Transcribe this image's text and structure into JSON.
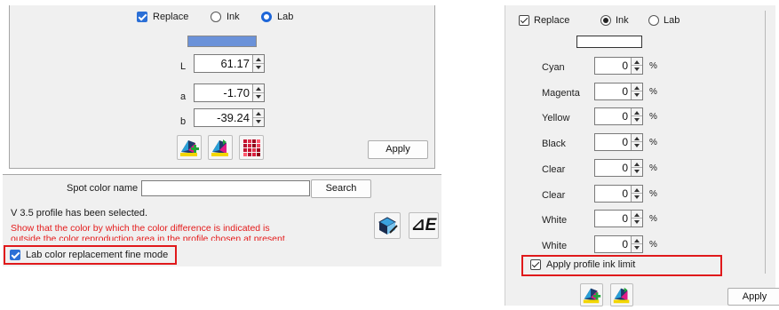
{
  "left": {
    "replace_label": "Replace",
    "mode_ink_label": "Ink",
    "mode_lab_label": "Lab",
    "swatch_color": "#6b92d9",
    "fields": [
      {
        "label": "L",
        "value": "61.17"
      },
      {
        "label": "a",
        "value": "-1.70"
      },
      {
        "label": "b",
        "value": "-39.24"
      }
    ],
    "icons": [
      "printer-add-icon",
      "printer-replace-icon",
      "color-grid-icon"
    ],
    "apply_label": "Apply",
    "spot_color_label": "Spot color name",
    "spot_color_value": "",
    "search_label": "Search",
    "profile_status": "V 3.5 profile has been selected.",
    "warning_line1": "Show that the color by which the color difference is indicated is",
    "warning_line2": "outside the color reproduction area in the profile chosen at present.",
    "fine_mode_label": "Lab color replacement fine mode",
    "delta_e_label": "⊿E",
    "colors": {
      "warning": "#e41b1b",
      "highlight": "#e0191b",
      "accent": "#2b6fd6"
    }
  },
  "right": {
    "replace_label": "Replace",
    "mode_ink_label": "Ink",
    "mode_lab_label": "Lab",
    "inks": [
      {
        "label": "Cyan",
        "value": "0"
      },
      {
        "label": "Magenta",
        "value": "0"
      },
      {
        "label": "Yellow",
        "value": "0"
      },
      {
        "label": "Black",
        "value": "0"
      },
      {
        "label": "Clear",
        "value": "0"
      },
      {
        "label": "Clear",
        "value": "0"
      },
      {
        "label": "White",
        "value": "0"
      },
      {
        "label": "White",
        "value": "0"
      }
    ],
    "percent": "%",
    "ink_limit_label": "Apply profile ink limit",
    "apply_label": "Apply"
  }
}
